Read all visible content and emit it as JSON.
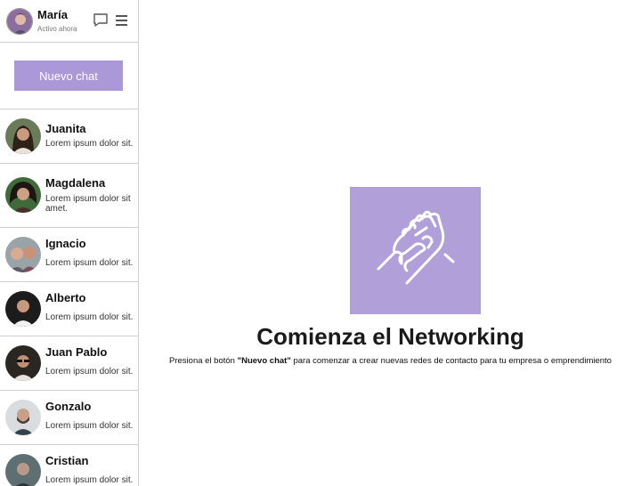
{
  "profile": {
    "name": "María",
    "status": "Activo ahora",
    "avatar_icon": "user-avatar",
    "chat_icon": "chat-bubble-icon",
    "menu_icon": "hamburger-menu-icon"
  },
  "sidebar": {
    "new_chat_label": "Nuevo chat",
    "contacts": [
      {
        "name": "Juanita",
        "message": "Lorem ipsum dolor sit."
      },
      {
        "name": "Magdalena",
        "message": "Lorem ipsum dolor sit amet."
      },
      {
        "name": "Ignacio",
        "message": "Lorem ipsum dolor sit."
      },
      {
        "name": "Alberto",
        "message": "Lorem ipsum dolor sit."
      },
      {
        "name": "Juan Pablo",
        "message": "Lorem ipsum dolor sit."
      },
      {
        "name": "Gonzalo",
        "message": "Lorem ipsum dolor sit."
      },
      {
        "name": "Cristian",
        "message": "Lorem ipsum dolor sit."
      }
    ]
  },
  "main": {
    "icon": "handshake-icon",
    "title": "Comienza el Networking",
    "desc_before": "Presiona el botón ",
    "desc_bold": "\"Nuevo chat\"",
    "desc_after": " para comenzar a crear nuevas redes de contacto para tu empresa o emprendimiento"
  },
  "colors": {
    "accent": "#ab98d9",
    "accent_box": "#b09fd8",
    "divider": "#cfcfcf"
  }
}
